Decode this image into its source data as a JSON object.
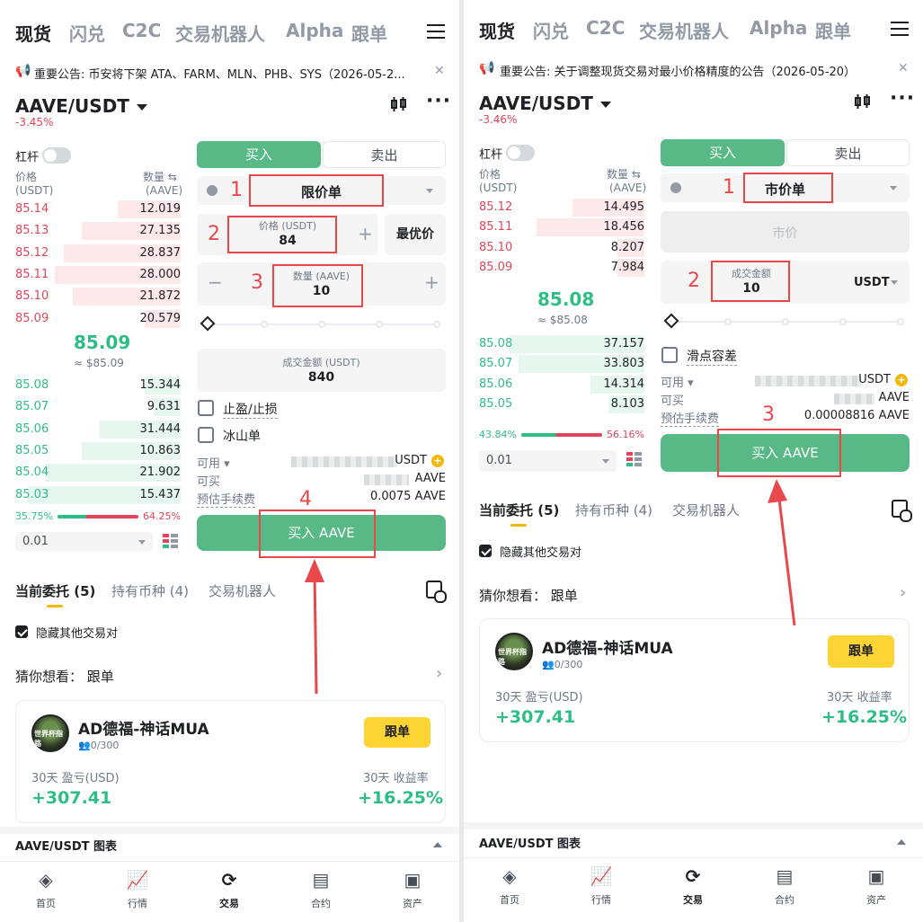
{
  "topnav": {
    "items": [
      "现货",
      "闪兑",
      "C2C",
      "交易机器人",
      "Alpha",
      "跟单"
    ]
  },
  "left": {
    "notice": "重要公告: 币安将下架 ATA、FARM、MLN、PHB、SYS（2026-05-2...",
    "pair": "AAVE/USDT",
    "change": "-3.45%",
    "leverage_label": "杠杆",
    "price_header": "价格",
    "price_unit": "(USDT)",
    "qty_header": "数量 ⇆",
    "qty_unit": "(AAVE)",
    "asks": [
      {
        "price": "85.14",
        "qty": "12.019"
      },
      {
        "price": "85.13",
        "qty": "27.135"
      },
      {
        "price": "85.12",
        "qty": "28.837"
      },
      {
        "price": "85.11",
        "qty": "28.000"
      },
      {
        "price": "85.10",
        "qty": "21.872"
      },
      {
        "price": "85.09",
        "qty": "20.579"
      }
    ],
    "mid_price": "85.09",
    "mid_fiat": "≈ $85.09",
    "bids": [
      {
        "price": "85.08",
        "qty": "15.344"
      },
      {
        "price": "85.07",
        "qty": "9.631"
      },
      {
        "price": "85.06",
        "qty": "31.444"
      },
      {
        "price": "85.05",
        "qty": "10.863"
      },
      {
        "price": "85.04",
        "qty": "21.902"
      },
      {
        "price": "85.03",
        "qty": "15.437"
      }
    ],
    "ratio_buy": "35.75%",
    "ratio_sell": "64.25%",
    "ratio_buy_fraction": 0.3575,
    "precision": "0.01",
    "buy_tab": "买入",
    "sell_tab": "卖出",
    "order_type": "限价单",
    "price_label": "价格 (USDT)",
    "price_value": "84",
    "best_price": "最优价",
    "qty_label": "数量 (AAVE)",
    "qty_value": "10",
    "total_label": "成交金额 (USDT)",
    "total_value": "840",
    "tpsl": "止盈/止损",
    "iceberg": "冰山单",
    "available_label": "可用",
    "available_unit": "USDT",
    "can_buy_label": "可买",
    "can_buy_unit": "AAVE",
    "fee_label": "预估手续费",
    "fee_value": "0.0075 AAVE",
    "buy_button": "买入 AAVE",
    "steps": [
      "1",
      "2",
      "3",
      "4"
    ],
    "tabs": [
      "当前委托 (5)",
      "持有币种 (4)",
      "交易机器人"
    ],
    "hide_other": "隐藏其他交易对",
    "guess": "猜你想看：  跟单",
    "trader": "AD德福-神话MUA",
    "avatar_text": "世界杯指路",
    "followers": "0/300",
    "follow": "跟单",
    "pnl_label": "30天 盈亏(USD)",
    "pnl_value": "+307.41",
    "roi_label": "30天 收益率",
    "roi_value": "+16.25%",
    "chart_bar": "AAVE/USDT 图表"
  },
  "right": {
    "notice": "重要公告: 关于调整现货交易对最小价格精度的公告（2026-05-20）",
    "pair": "AAVE/USDT",
    "change": "-3.46%",
    "leverage_label": "杠杆",
    "price_header": "价格",
    "price_unit": "(USDT)",
    "qty_header": "数量 ⇆",
    "qty_unit": "(AAVE)",
    "asks": [
      {
        "price": "85.12",
        "qty": "14.495"
      },
      {
        "price": "85.11",
        "qty": "18.456"
      },
      {
        "price": "85.10",
        "qty": "8.207"
      },
      {
        "price": "85.09",
        "qty": "7.984"
      }
    ],
    "mid_price": "85.08",
    "mid_fiat": "≈ $85.08",
    "bids": [
      {
        "price": "85.08",
        "qty": "37.157"
      },
      {
        "price": "85.07",
        "qty": "33.803"
      },
      {
        "price": "85.06",
        "qty": "14.314"
      },
      {
        "price": "85.05",
        "qty": "8.103"
      }
    ],
    "ratio_buy": "43.84%",
    "ratio_sell": "56.16%",
    "ratio_buy_fraction": 0.4384,
    "precision": "0.01",
    "buy_tab": "买入",
    "sell_tab": "卖出",
    "order_type": "市价单",
    "market_placeholder": "市价",
    "total_label": "成交金额",
    "total_value": "10",
    "total_unit": "USDT",
    "slippage": "滑点容差",
    "available_label": "可用",
    "available_unit": "USDT",
    "can_buy_label": "可买",
    "can_buy_unit": "AAVE",
    "fee_label": "预估手续费",
    "fee_value": "0.00008816 AAVE",
    "buy_button": "买入 AAVE",
    "steps": [
      "1",
      "2",
      "3"
    ],
    "tabs": [
      "当前委托 (5)",
      "持有币种 (4)",
      "交易机器人"
    ],
    "hide_other": "隐藏其他交易对",
    "guess": "猜你想看：  跟单",
    "trader": "AD德福-神话MUA",
    "avatar_text": "世界杯指路",
    "followers": "0/300",
    "follow": "跟单",
    "pnl_label": "30天 盈亏(USD)",
    "pnl_value": "+307.41",
    "roi_label": "30天 收益率",
    "roi_value": "+16.25%",
    "chart_bar": "AAVE/USDT 图表"
  },
  "bottom_nav": [
    {
      "label": "首页",
      "icon": "home-icon"
    },
    {
      "label": "行情",
      "icon": "markets-icon"
    },
    {
      "label": "交易",
      "icon": "trade-icon"
    },
    {
      "label": "合约",
      "icon": "futures-icon"
    },
    {
      "label": "资产",
      "icon": "wallet-icon"
    }
  ],
  "colors": {
    "buy": "#58b987",
    "ask": "#e0455a",
    "bid": "#2ebd85",
    "annotation": "#e8484c",
    "follow": "#fcd535"
  }
}
